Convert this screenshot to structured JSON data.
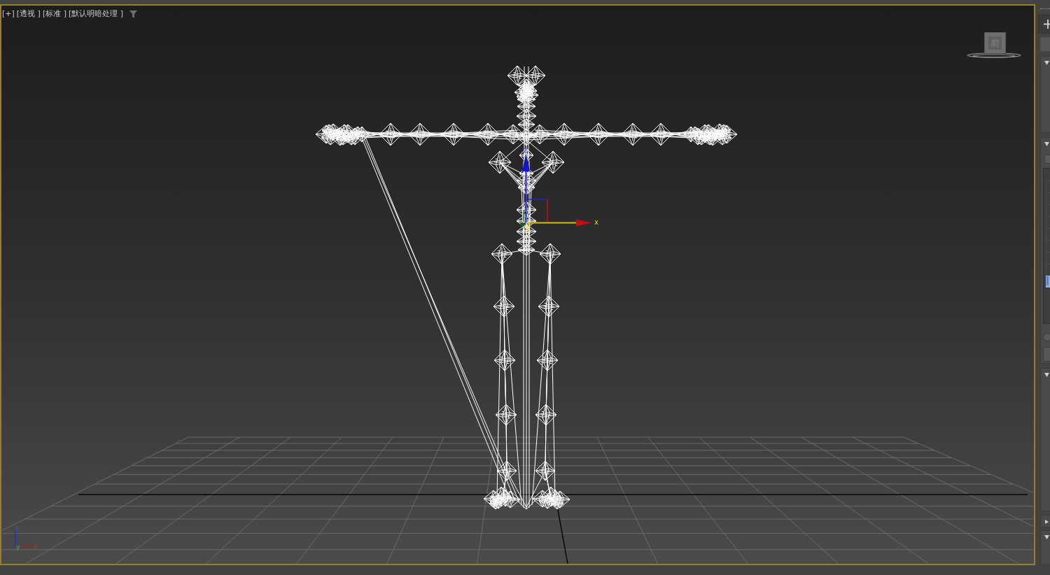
{
  "viewport": {
    "labels": [
      "[+]",
      "[透视 ]",
      "[标准 ]",
      "[默认明暗处理 ]"
    ],
    "viewcube": {
      "face": "前"
    },
    "move_gizmo": {
      "z_label": "z",
      "y_label": "y",
      "x_label": "x"
    },
    "axis_tripod": {
      "z_label": "z",
      "y_label": "y",
      "x_label": "x"
    }
  },
  "command_panel": {
    "rollouts": [
      {
        "expanded": true
      },
      {
        "expanded": true,
        "checkbox": {
          "checked": false
        },
        "list_rows": [
          {
            "selected": false
          },
          {
            "selected": false
          },
          {
            "selected": false
          },
          {
            "selected": false
          },
          {
            "selected": false
          },
          {
            "selected": false
          },
          {
            "selected": false
          },
          {
            "selected": false
          },
          {
            "selected": true
          }
        ],
        "radio": {
          "selected": false
        }
      },
      {
        "expanded": true
      },
      {
        "expanded": false
      },
      {
        "expanded": true
      }
    ]
  }
}
